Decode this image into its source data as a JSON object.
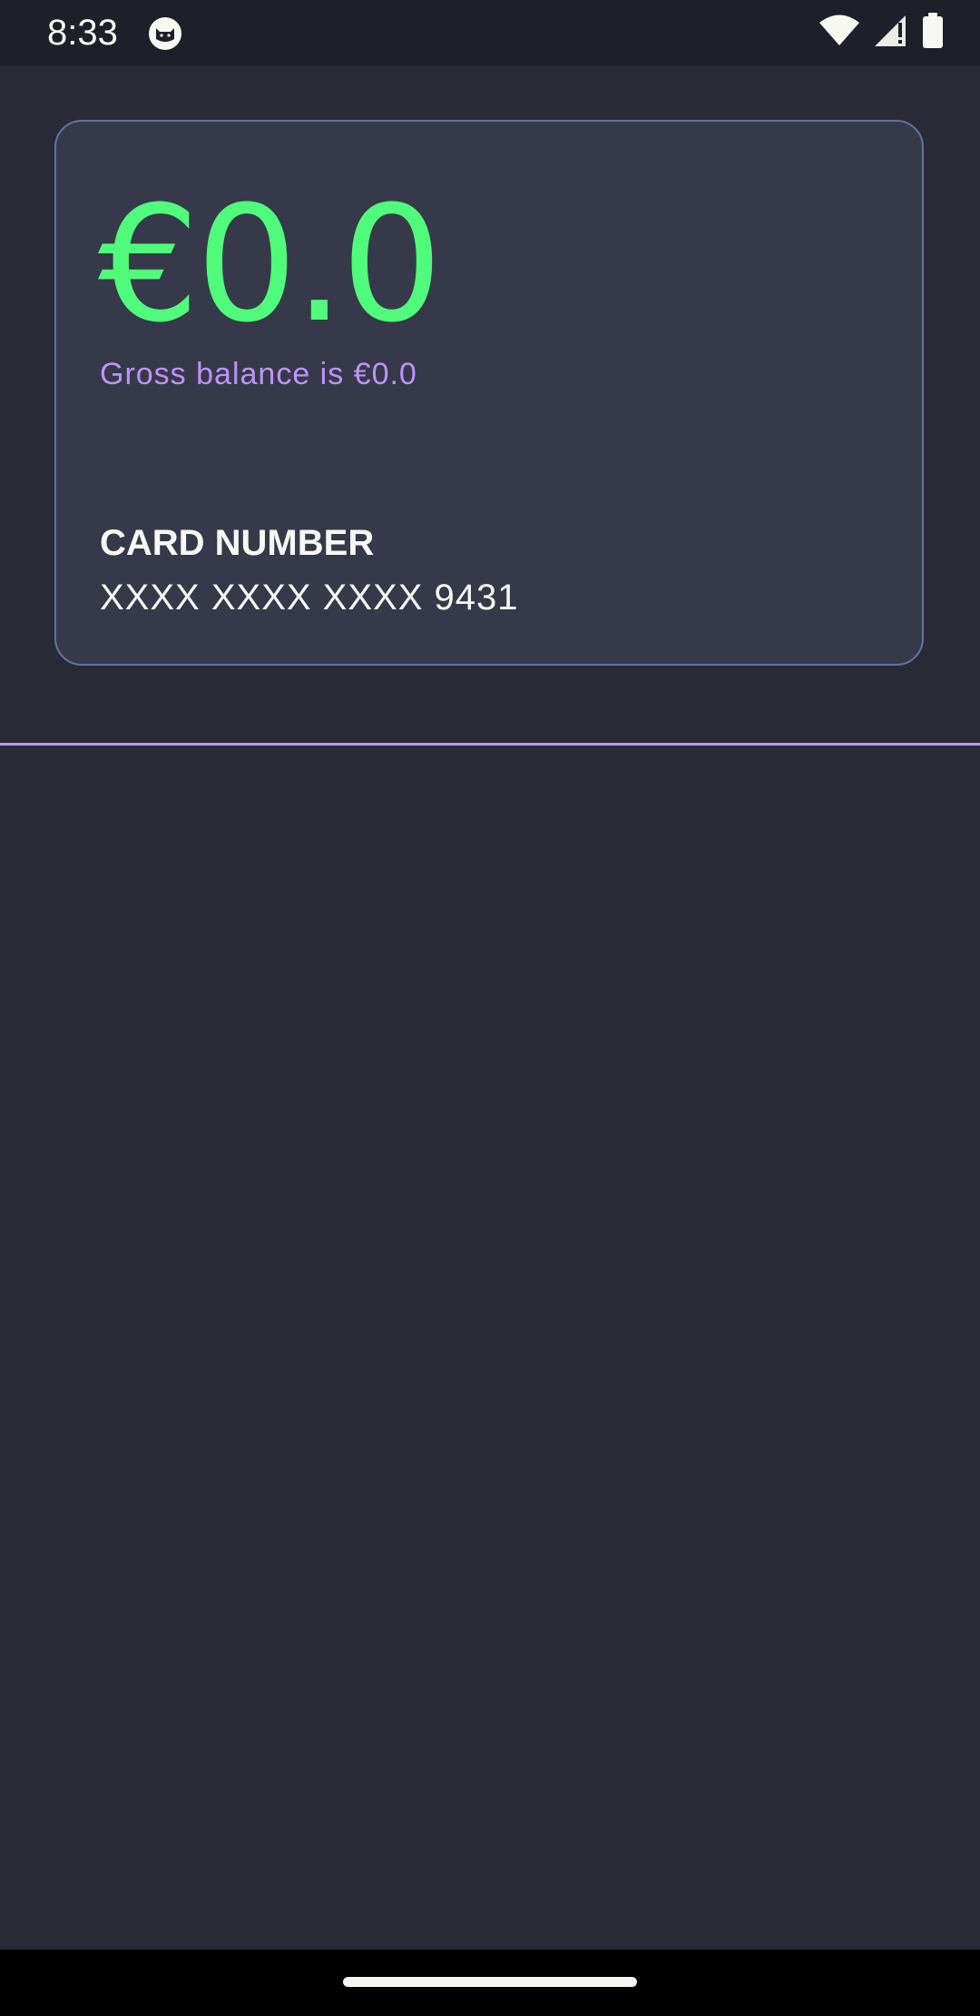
{
  "status_bar": {
    "time": "8:33",
    "icons": [
      "cat-notification-icon",
      "wifi-icon",
      "cellular-signal-icon",
      "battery-icon"
    ]
  },
  "card": {
    "balance": "€0.0",
    "gross_balance_text": "Gross balance is €0.0",
    "card_number_label": "CARD NUMBER",
    "card_number_value": "XXXX XXXX XXXX 9431"
  },
  "colors": {
    "background": "#282a36",
    "card_background": "#363949",
    "card_border": "#6272a4",
    "balance_green": "#50fa7b",
    "accent_purple": "#bd93f9",
    "text": "#f8f8f2"
  }
}
